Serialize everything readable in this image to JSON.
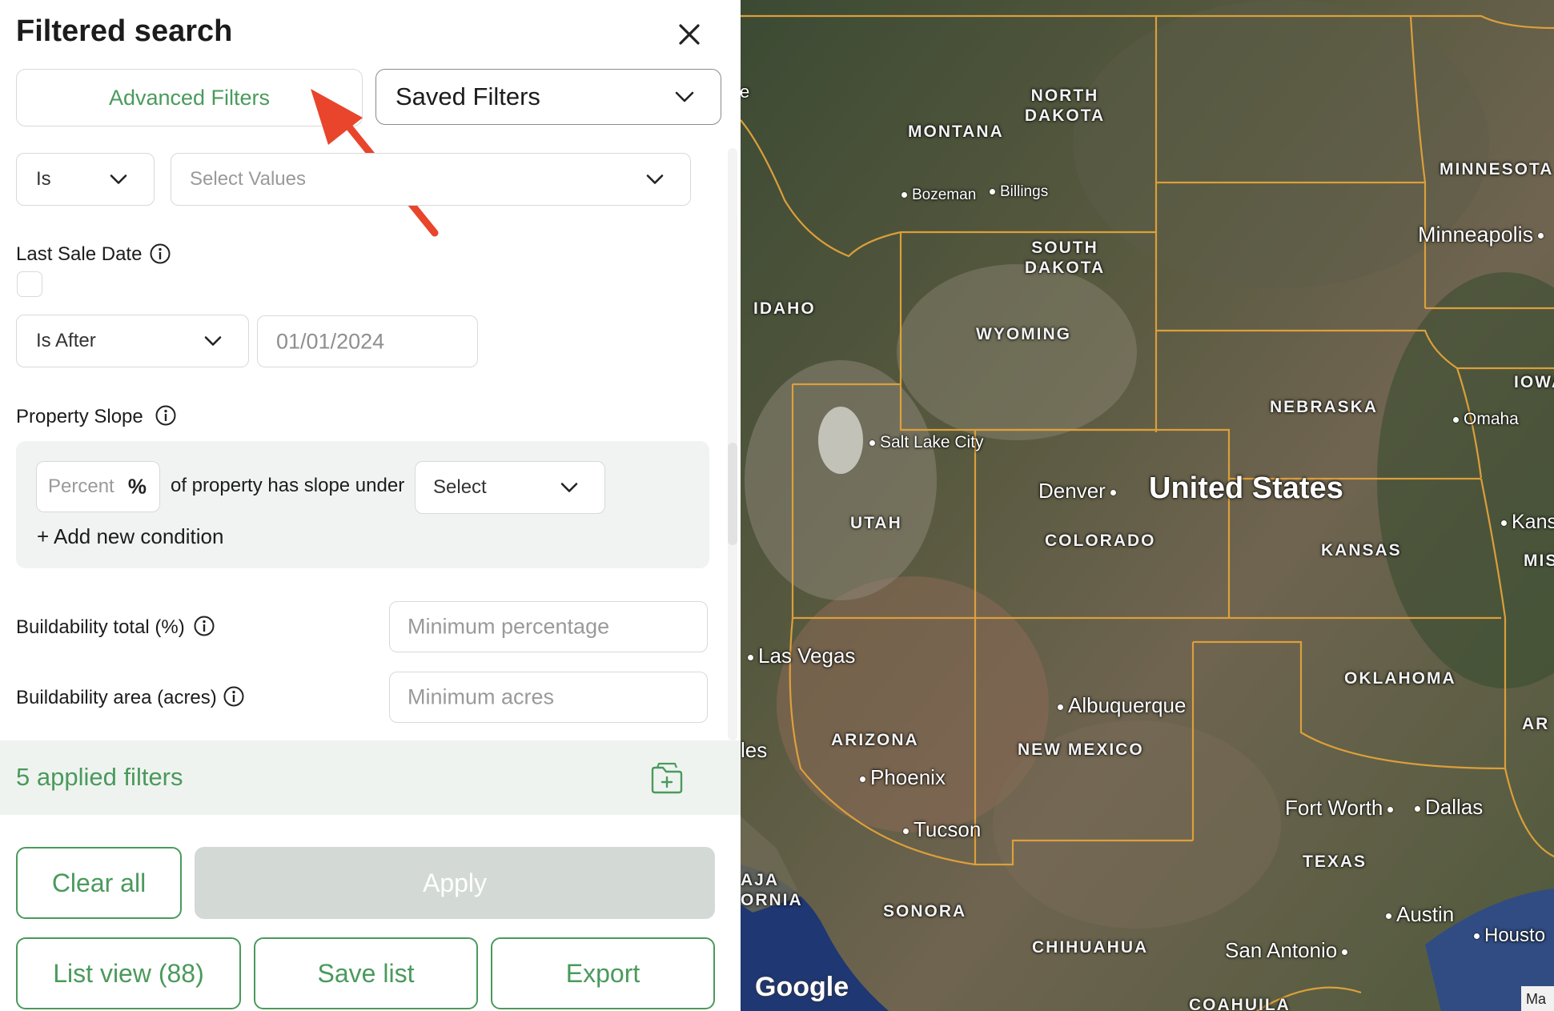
{
  "header": {
    "title": "Filtered search"
  },
  "tabs": {
    "advanced_filters": "Advanced Filters",
    "saved_filters": "Saved Filters"
  },
  "filter_row": {
    "operator": "Is",
    "values_placeholder": "Select Values"
  },
  "last_sale_date": {
    "label": "Last Sale Date",
    "operator": "Is After",
    "date": "01/01/2024"
  },
  "property_slope": {
    "label": "Property Slope",
    "percent_placeholder": "Percent",
    "percent_symbol": "%",
    "condition_text": "of property has slope under",
    "select_placeholder": "Select",
    "add_condition": "+ Add new condition"
  },
  "buildability_total": {
    "label": "Buildability total (%)",
    "placeholder": "Minimum percentage"
  },
  "buildability_area": {
    "label": "Buildability area (acres)",
    "placeholder": "Minimum acres"
  },
  "applied": {
    "text": "5 applied filters"
  },
  "actions": {
    "clear_all": "Clear all",
    "apply": "Apply",
    "list_view": "List view (88)",
    "save_list": "Save list",
    "export": "Export"
  },
  "map": {
    "country": "United States",
    "states": [
      "MONTANA",
      "NORTH DAKOTA",
      "SOUTH DAKOTA",
      "MINNESOTA",
      "IDAHO",
      "WYOMING",
      "NEBRASKA",
      "IOWA",
      "UTAH",
      "COLORADO",
      "KANSAS",
      "MIS",
      "OKLAHOMA",
      "AR",
      "ARIZONA",
      "NEW MEXICO",
      "TEXAS",
      "SONORA",
      "CHIHUAHUA",
      "COAHUILA",
      "AJA",
      "ORNIA"
    ],
    "cities": [
      "Bozeman",
      "Billings",
      "Minneapolis",
      "Salt Lake City",
      "Omaha",
      "Denver",
      "Kans",
      "Las Vegas",
      "Albuquerque",
      "les",
      "Phoenix",
      "Tucson",
      "Fort Worth",
      "Dallas",
      "Austin",
      "Housto",
      "San Antonio"
    ],
    "edge_letter": "e",
    "attribution": "Google",
    "map_corner": "Ma"
  },
  "colors": {
    "accent_green": "#4a9a5c",
    "state_border": "#e3a33a",
    "arrow": "#e8452c"
  }
}
